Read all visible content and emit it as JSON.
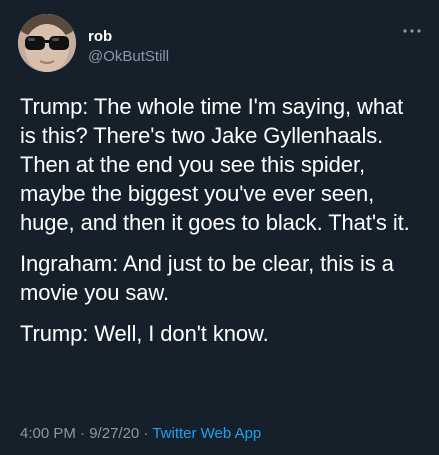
{
  "user": {
    "display_name": "rob",
    "handle": "@OkButStill",
    "more_icon": "more-horizontal-icon"
  },
  "tweet": {
    "paragraphs": [
      "Trump: The whole time I'm saying, what is this? There's two Jake Gyllenhaals. Then at the end you see this spider, maybe the biggest you've ever seen, huge, and then it goes to black. That's it.",
      "Ingraham: And just to be clear, this is a movie you saw.",
      "Trump: Well, I don't know."
    ]
  },
  "meta": {
    "time": "4:00 PM",
    "separator": " · ",
    "date": "9/27/20",
    "source": "Twitter Web App"
  },
  "colors": {
    "background": "#15202b",
    "text": "#ffffff",
    "secondary": "#8899a6",
    "link": "#1da1f2"
  }
}
